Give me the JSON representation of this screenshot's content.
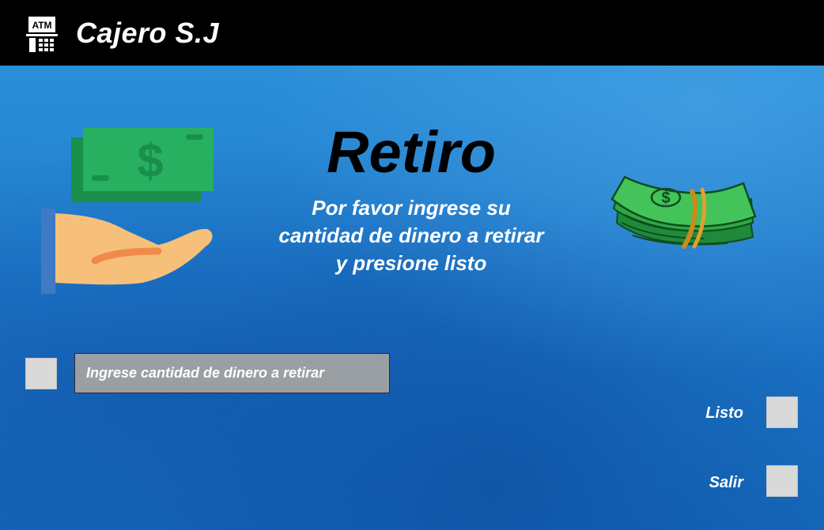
{
  "header": {
    "logo_text": "ATM",
    "title": "Cajero S.J"
  },
  "main": {
    "heading": "Retiro",
    "instructions": "Por favor ingrese su cantidad de dinero a retirar  y presione listo",
    "amount_input": {
      "placeholder": "Ingrese cantidad de dinero a retirar",
      "value": ""
    }
  },
  "actions": {
    "done_label": "Listo",
    "exit_label": "Salir"
  },
  "icons": [
    "atm-icon",
    "hand-money-icon",
    "cash-bundle-icon"
  ],
  "colors": {
    "header_bg": "#000000",
    "background": "#1f78c8",
    "heading_text": "#000000",
    "body_text": "#ffffff",
    "input_bg": "#9a9fa3",
    "checkbox": "#d9d9d9",
    "money_green": "#27b060"
  }
}
